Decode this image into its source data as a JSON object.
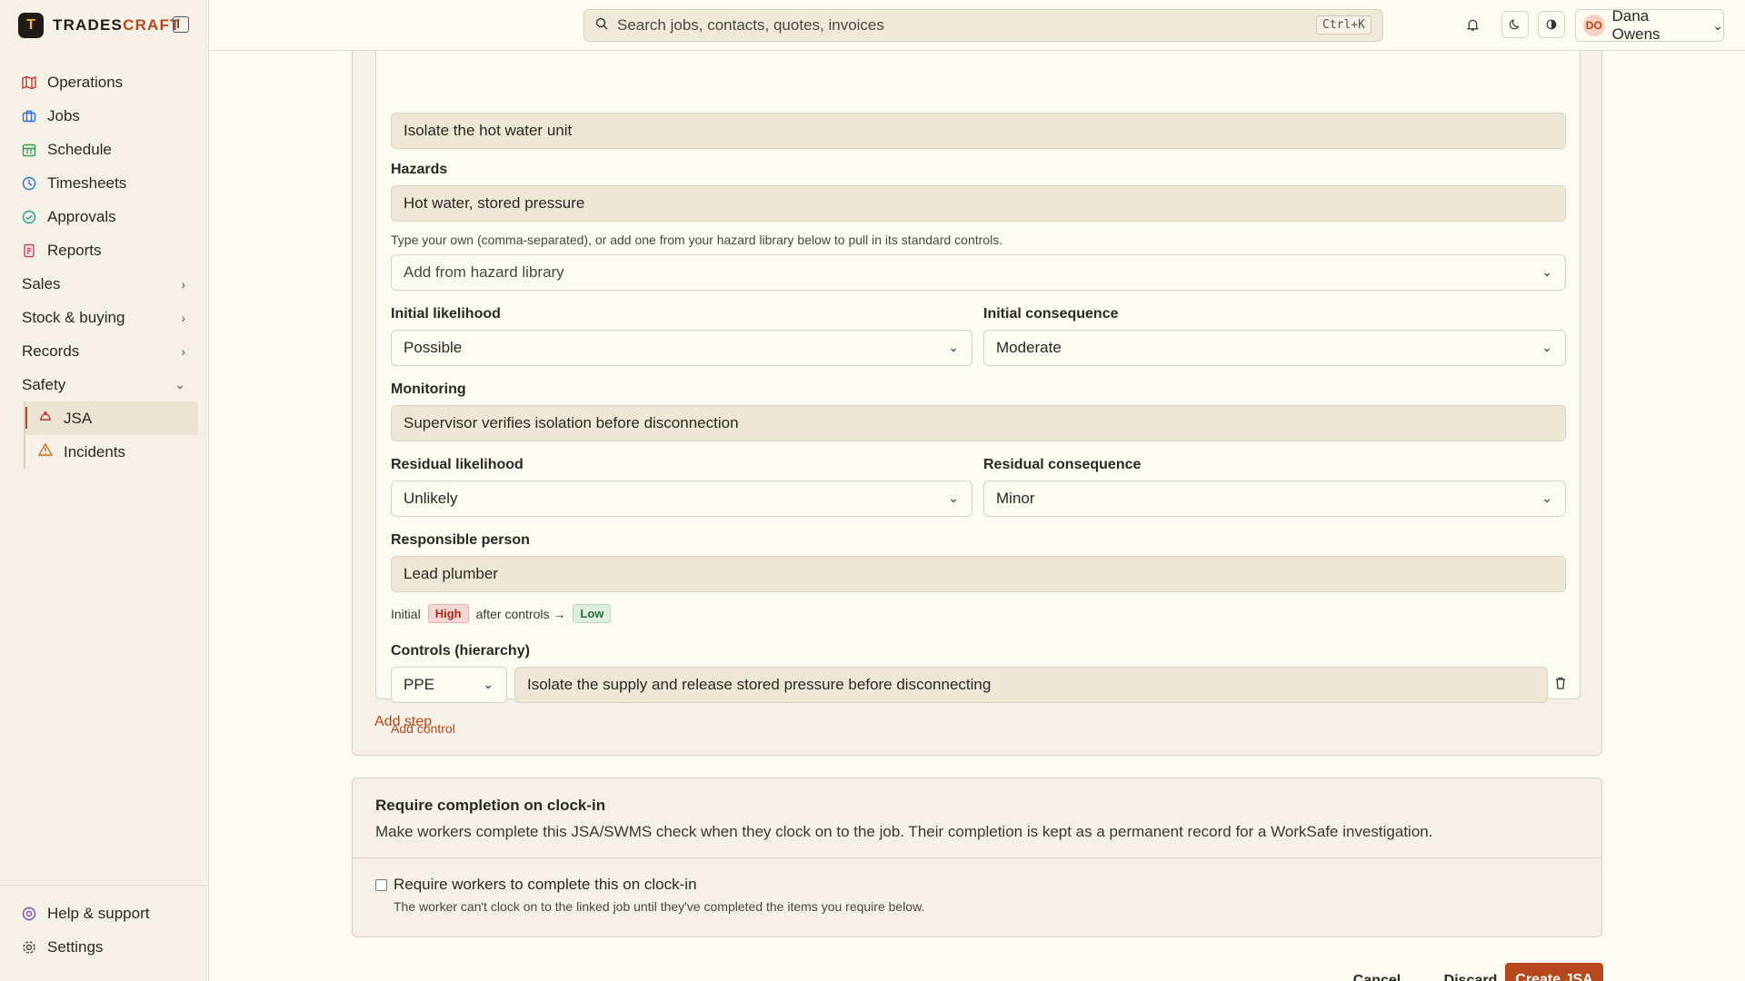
{
  "brand": {
    "logo": "T",
    "name_a": "TRADES",
    "name_b": "CRAFT"
  },
  "sidebar": {
    "items": [
      {
        "label": "Operations",
        "icon": "map-icon"
      },
      {
        "label": "Jobs",
        "icon": "briefcase-icon"
      },
      {
        "label": "Schedule",
        "icon": "calendar-icon"
      },
      {
        "label": "Timesheets",
        "icon": "clock-icon"
      },
      {
        "label": "Approvals",
        "icon": "check-circle-icon"
      },
      {
        "label": "Reports",
        "icon": "report-icon"
      }
    ],
    "groups": [
      {
        "label": "Sales"
      },
      {
        "label": "Stock & buying"
      },
      {
        "label": "Records"
      },
      {
        "label": "Safety"
      }
    ],
    "safety_items": [
      {
        "label": "JSA",
        "icon": "hardhat-icon"
      },
      {
        "label": "Incidents",
        "icon": "warning-icon"
      }
    ],
    "bottom": [
      {
        "label": "Help & support",
        "icon": "help-icon"
      },
      {
        "label": "Settings",
        "icon": "gear-icon"
      }
    ]
  },
  "topbar": {
    "search_placeholder": "Search jobs, contacts, quotes, invoices",
    "shortcut": "Ctrl+K",
    "user_initials": "DO",
    "user_name": "Dana Owens"
  },
  "step": {
    "task_value": "Isolate the hot water unit",
    "hazards_label": "Hazards",
    "hazards_value": "Hot water, stored pressure",
    "hazards_hint": "Type your own (comma-separated), or add one from your hazard library below to pull in its standard controls.",
    "hazard_library_placeholder": "Add from hazard library",
    "initial_likelihood_label": "Initial likelihood",
    "initial_likelihood_value": "Possible",
    "initial_consequence_label": "Initial consequence",
    "initial_consequence_value": "Moderate",
    "monitoring_label": "Monitoring",
    "monitoring_value": "Supervisor verifies isolation before disconnection",
    "residual_likelihood_label": "Residual likelihood",
    "residual_likelihood_value": "Unlikely",
    "residual_consequence_label": "Residual consequence",
    "residual_consequence_value": "Minor",
    "responsible_label": "Responsible person",
    "responsible_value": "Lead plumber",
    "risk_initial_text": "Initial",
    "risk_initial_level": "High",
    "risk_after_text": "after controls →",
    "risk_after_level": "Low",
    "controls_label": "Controls (hierarchy)",
    "control_type": "PPE",
    "control_text": "Isolate the supply and release stored pressure before disconnecting",
    "add_control": "Add control"
  },
  "add_step": "Add step",
  "clockin": {
    "title": "Require completion on clock-in",
    "description": "Make workers complete this JSA/SWMS check when they clock on to the job. Their completion is kept as a permanent record for a WorkSafe investigation.",
    "checkbox_label": "Require workers to complete this on clock-in",
    "checkbox_hint": "The worker can't clock on to the linked job until they've completed the items you require below.",
    "checked": false
  },
  "footer": {
    "cancel": "Cancel",
    "discard": "Discard",
    "create": "Create JSA"
  },
  "colors": {
    "accent": "#b5481c",
    "high": "#b0261b",
    "low": "#2f6b3a"
  }
}
